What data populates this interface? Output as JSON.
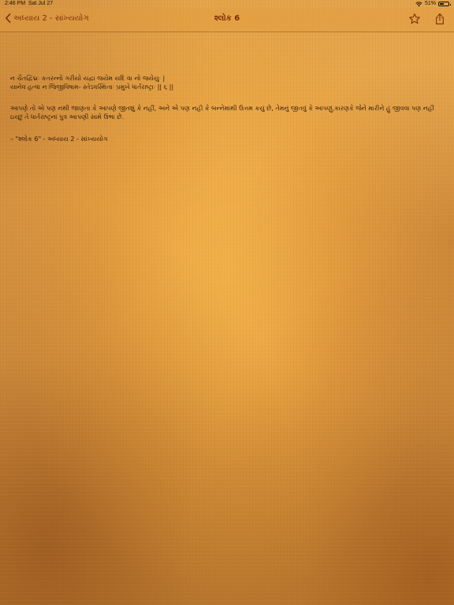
{
  "statusbar": {
    "time": "2:46 PM",
    "date": "Sat Jul 27",
    "battery_percent": "51%",
    "battery_level": 0.51
  },
  "navbar": {
    "back_label": "અધ્યાય 2 - સાંખ્યયોગ",
    "title": "શ્લોક 6",
    "accent_color": "#7a2c06"
  },
  "content": {
    "verse": "ન ચૈતદ્વિદ્મઃ કતરન્નો ગરીયો યદ્વા જયેમ યદિ વા નો જયેયુઃ |\nયાનેવ હત્વા ન જિજીવિષામ- સ્તેઽવસ્થિતાઃ પ્રમુખે ધાર્તરાષ્ટ્રાઃ || ૬ ||",
    "translation": "આપણે તો એ પણ નથી જાણતા કે આપણે જીતશું કે નહીં, અને એ પણ નહી કે બન્નેમાંથી ઉત્તમ કયું છે, તેમનું જીતવું કે આપણું,કારણકે જેને મારીને હું જીવવા પણ નહીં ઇચ્છું તે ધાર્તરાષ્ટ્રનાં પુત્ર આપણી સામે ઉભા છે.",
    "reference": "– \"શ્લોક 6\" - અધ્યાય 2 - સાંખ્યયોગ"
  }
}
